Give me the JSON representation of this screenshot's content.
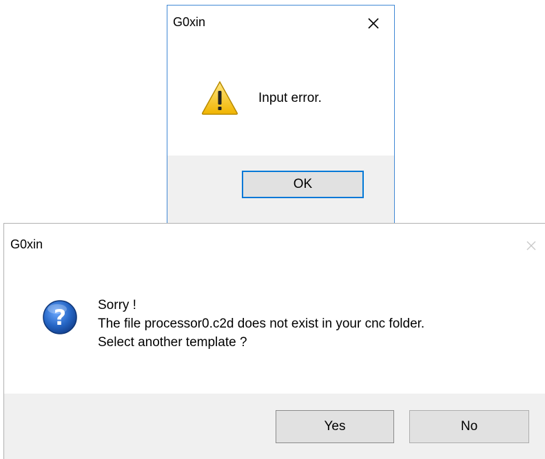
{
  "dialog_error": {
    "title": "G0xin",
    "message": "Input error.",
    "icon": "warning-icon",
    "ok_label": "OK"
  },
  "dialog_question": {
    "title": "G0xin",
    "message_lines": [
      "Sorry !",
      "The file processor0.c2d does not exist in your cnc folder.",
      "Select another template ?"
    ],
    "icon": "question-icon",
    "yes_label": "Yes",
    "no_label": "No"
  },
  "colors": {
    "accent_border": "#3f87d4",
    "footer_bg": "#f0f0f0",
    "button_bg": "#e1e1e1",
    "warning_yellow": "#f5c518",
    "question_blue": "#1f5fb8"
  }
}
